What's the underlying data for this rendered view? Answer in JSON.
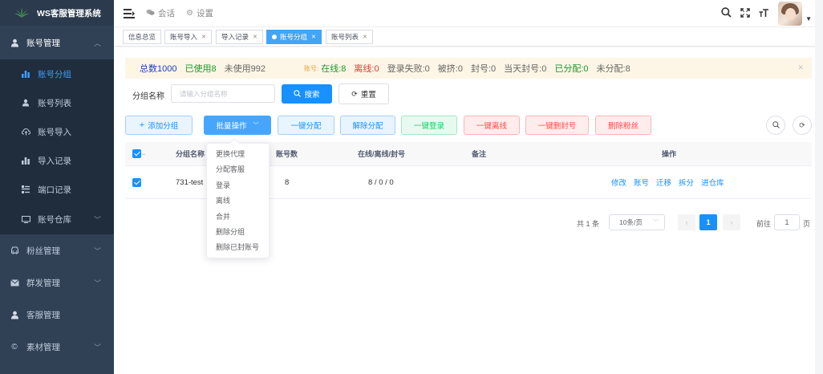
{
  "sidebar": {
    "title": "WS客服管理系统",
    "account_menu": {
      "label": "账号管理",
      "icon": "user-icon"
    },
    "submenu": [
      {
        "label": "账号分组",
        "icon": "bar-chart-icon",
        "active": true
      },
      {
        "label": "账号列表",
        "icon": "user-icon"
      },
      {
        "label": "账号导入",
        "icon": "cloud-upload-icon"
      },
      {
        "label": "导入记录",
        "icon": "bar-chart-icon"
      },
      {
        "label": "端口记录",
        "icon": "port-icon"
      },
      {
        "label": "账号仓库",
        "icon": "monitor-icon"
      }
    ],
    "menus": [
      {
        "label": "粉丝管理",
        "icon": "car-icon"
      },
      {
        "label": "群发管理",
        "icon": "mail-icon"
      },
      {
        "label": "客服管理",
        "icon": "user-icon"
      },
      {
        "label": "素材管理",
        "icon": "copyright-icon"
      }
    ]
  },
  "topbar": {
    "links": [
      {
        "label": "会话",
        "icon": "chat-icon"
      },
      {
        "label": "设置",
        "icon": "gear-icon"
      }
    ]
  },
  "tags": [
    {
      "label": "信息总览",
      "closable": false,
      "active": false
    },
    {
      "label": "账号导入",
      "closable": true,
      "active": false
    },
    {
      "label": "导入记录",
      "closable": true,
      "active": false
    },
    {
      "label": "账号分组",
      "closable": true,
      "active": true
    },
    {
      "label": "账号列表",
      "closable": true,
      "active": false
    }
  ],
  "stats": {
    "total": "总数1000",
    "used": "已使用8",
    "unused": "未使用992",
    "account_prefix": "账号:",
    "online": "在线:8",
    "offline": "离线:0",
    "login_fail": "登录失败:0",
    "kicked": "被挤:0",
    "banned": "封号:0",
    "banned_today": "当天封号:0",
    "assigned": "已分配:0",
    "unassigned": "未分配:8",
    "colors": {
      "total": "#1d3cc9",
      "used": "#1a9a2a",
      "online": "#1a9a2a",
      "offline": "#e53935",
      "assigned": "#1a9a2a",
      "prefix": "#e8a23a"
    }
  },
  "search": {
    "label": "分组名称",
    "placeholder": "请输入分组名称",
    "search_btn": "搜索",
    "reset_btn": "重置"
  },
  "actions": {
    "add_group": "添加分组",
    "batch": "批量操作",
    "assign_one_key": "一键分配",
    "unassign": "解除分配",
    "login_one_key": "一键登录",
    "offline_one_key": "一键离线",
    "delete_banned": "一键删封号",
    "delete_fans": "删除粉丝"
  },
  "table": {
    "columns": [
      "分组名称",
      "账号数",
      "在线/离线/封号",
      "备注",
      "操作"
    ],
    "rows": [
      {
        "name": "731-test",
        "count": "8",
        "status": "8 / 0 / 0",
        "remark": "",
        "ops": [
          "修改",
          "账号",
          "迁移",
          "拆分",
          "进仓库"
        ]
      }
    ]
  },
  "pagination": {
    "total": "共 1 条",
    "page_size": "10条/页",
    "current": "1",
    "goto_label": "前往",
    "goto_value": "1",
    "goto_suffix": "页"
  },
  "dropdown": {
    "items": [
      "更换代理",
      "分配客服",
      "登录",
      "离线",
      "合并",
      "删除分组",
      "删除已封账号"
    ]
  }
}
